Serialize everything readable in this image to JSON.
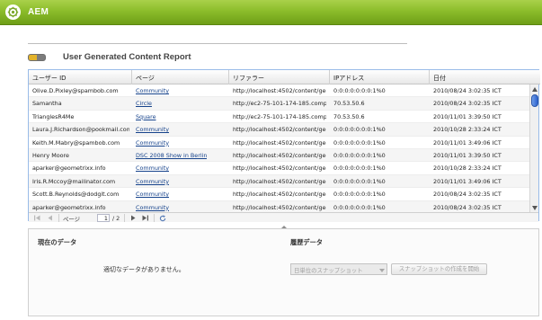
{
  "app": {
    "title": "AEM"
  },
  "report": {
    "title": "User Generated Content Report"
  },
  "grid": {
    "columns": [
      "ユーザー ID",
      "ページ",
      "リファラー",
      "IPアドレス",
      "日付"
    ],
    "rows": [
      {
        "user": "Olive.D.Pixley@spambob.com",
        "page": "Community",
        "referrer": "http://localhost:4502/content/geo",
        "ip": "0:0:0:0:0:0:0:1%0",
        "date": "2010/08/24 3:02:35 ICT"
      },
      {
        "user": "Samantha",
        "page": "Circle",
        "referrer": "http://ec2-75-101-174-185.compu",
        "ip": "70.53.50.6",
        "date": "2010/08/24 3:02:35 ICT"
      },
      {
        "user": "TrianglesR4Me",
        "page": "Square",
        "referrer": "http://ec2-75-101-174-185.compu",
        "ip": "70.53.50.6",
        "date": "2010/11/01 3:39:50 ICT"
      },
      {
        "user": "Laura.J.Richardson@pookmail.com",
        "page": "Community",
        "referrer": "http://localhost:4502/content/geo",
        "ip": "0:0:0:0:0:0:0:1%0",
        "date": "2010/10/28 2:33:24 ICT"
      },
      {
        "user": "Keith.M.Mabry@spambob.com",
        "page": "Community",
        "referrer": "http://localhost:4502/content/geo",
        "ip": "0:0:0:0:0:0:0:1%0",
        "date": "2010/11/01 3:49:06 ICT"
      },
      {
        "user": "Henry Moore",
        "page": "DSC 2008 Show in Berlin",
        "referrer": "http://localhost:4502/content/geo",
        "ip": "0:0:0:0:0:0:0:1%0",
        "date": "2010/11/01 3:39:50 ICT"
      },
      {
        "user": "aparker@geometrixx.info",
        "page": "Community",
        "referrer": "http://localhost:4502/content/geo",
        "ip": "0:0:0:0:0:0:0:1%0",
        "date": "2010/10/28 2:33:24 ICT"
      },
      {
        "user": "Iris.R.Mccoy@mailinator.com",
        "page": "Community",
        "referrer": "http://localhost:4502/content/geo",
        "ip": "0:0:0:0:0:0:0:1%0",
        "date": "2010/11/01 3:49:06 ICT"
      },
      {
        "user": "Scott.B.Reynolds@dodgit.com",
        "page": "Community",
        "referrer": "http://localhost:4502/content/geo",
        "ip": "0:0:0:0:0:0:0:1%0",
        "date": "2010/08/24 3:02:35 ICT"
      },
      {
        "user": "aparker@geometrixx.info",
        "page": "Community",
        "referrer": "http://localhost:4502/content/geo",
        "ip": "0:0:0:0:0:0:0:1%0",
        "date": "2010/08/24 3:02:35 ICT"
      }
    ]
  },
  "pager": {
    "page_label": "ページ",
    "current_page": "1",
    "total_pages": "/ 2"
  },
  "current_data": {
    "title": "現在のデータ",
    "empty_message": "適切なデータがありません。"
  },
  "history": {
    "title": "履歴データ",
    "snapshot_select": "日単位のスナップショット",
    "create_button": "スナップショットの作成を開始"
  },
  "colors": {
    "brand_green": "#8cbd2b",
    "link": "#15428b",
    "header_border": "#99bbe8"
  }
}
